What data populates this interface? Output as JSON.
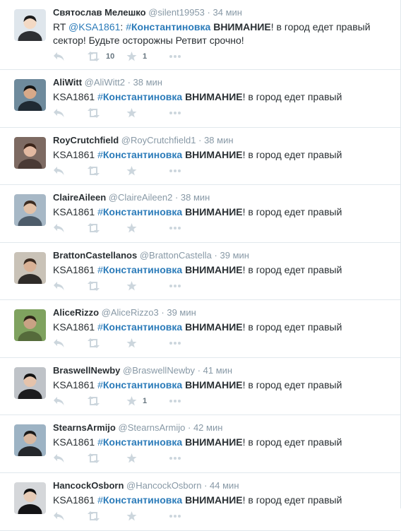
{
  "tweets": [
    {
      "fullname": "Святослав Мелешко",
      "username": "@silent19953",
      "time": "34 мин",
      "text": {
        "prefix": "RT ",
        "mention": "@KSA1861",
        "colon": ": ",
        "hash": "#",
        "hashtag": "Константиновка",
        "space": " ",
        "bold": "ВНИМАНИЕ",
        "rest": "! в город едет правый сектор! Будьте осторожны Ретвит срочно!"
      },
      "retweet_count": "10",
      "favorite_count": "1"
    },
    {
      "fullname": "AliWitt",
      "username": "@AliWitt2",
      "time": "38 мин",
      "text": {
        "prefix": "KSA1861 ",
        "mention": "",
        "colon": "",
        "hash": "#",
        "hashtag": "Константиновка",
        "space": " ",
        "bold": "ВНИМАНИЕ",
        "rest": "! в город едет правый"
      },
      "retweet_count": "",
      "favorite_count": ""
    },
    {
      "fullname": "RoyCrutchfield",
      "username": "@RoyCrutchfield1",
      "time": "38 мин",
      "text": {
        "prefix": "KSA1861 ",
        "mention": "",
        "colon": "",
        "hash": "#",
        "hashtag": "Константиновка",
        "space": " ",
        "bold": "ВНИМАНИЕ",
        "rest": "! в город едет правый"
      },
      "retweet_count": "",
      "favorite_count": ""
    },
    {
      "fullname": "ClaireAileen",
      "username": "@ClaireAileen2",
      "time": "38 мин",
      "text": {
        "prefix": "KSA1861 ",
        "mention": "",
        "colon": "",
        "hash": "#",
        "hashtag": "Константиновка",
        "space": " ",
        "bold": "ВНИМАНИЕ",
        "rest": "! в город едет правый"
      },
      "retweet_count": "",
      "favorite_count": ""
    },
    {
      "fullname": "BrattonCastellanos",
      "username": "@BrattonCastella",
      "time": "39 мин",
      "text": {
        "prefix": "KSA1861 ",
        "mention": "",
        "colon": "",
        "hash": "#",
        "hashtag": "Константиновка",
        "space": " ",
        "bold": "ВНИМАНИЕ",
        "rest": "! в город едет правый"
      },
      "retweet_count": "",
      "favorite_count": ""
    },
    {
      "fullname": "AliceRizzo",
      "username": "@AliceRizzo3",
      "time": "39 мин",
      "text": {
        "prefix": "KSA1861 ",
        "mention": "",
        "colon": "",
        "hash": "#",
        "hashtag": "Константиновка",
        "space": " ",
        "bold": "ВНИМАНИЕ",
        "rest": "! в город едет правый"
      },
      "retweet_count": "",
      "favorite_count": ""
    },
    {
      "fullname": "BraswellNewby",
      "username": "@BraswellNewby",
      "time": "41 мин",
      "text": {
        "prefix": "KSA1861 ",
        "mention": "",
        "colon": "",
        "hash": "#",
        "hashtag": "Константиновка",
        "space": " ",
        "bold": "ВНИМАНИЕ",
        "rest": "! в город едет правый"
      },
      "retweet_count": "",
      "favorite_count": "1"
    },
    {
      "fullname": "StearnsArmijo",
      "username": "@StearnsArmijo",
      "time": "42 мин",
      "text": {
        "prefix": "KSA1861 ",
        "mention": "",
        "colon": "",
        "hash": "#",
        "hashtag": "Константиновка",
        "space": " ",
        "bold": "ВНИМАНИЕ",
        "rest": "! в город едет правый"
      },
      "retweet_count": "",
      "favorite_count": ""
    },
    {
      "fullname": "HancockOsborn",
      "username": "@HancockOsborn",
      "time": "44 мин",
      "text": {
        "prefix": "KSA1861 ",
        "mention": "",
        "colon": "",
        "hash": "#",
        "hashtag": "Константиновка",
        "space": " ",
        "bold": "ВНИМАНИЕ",
        "rest": "! в город едет правый"
      },
      "retweet_count": "",
      "favorite_count": ""
    }
  ],
  "icons": {
    "reply": "reply-icon",
    "retweet": "retweet-icon",
    "favorite": "star-icon",
    "more": "more-icon",
    "avatar": "avatar-photo"
  },
  "colors": {
    "link": "#2b7bb9",
    "muted": "#8899a6",
    "action_icon": "#ccd6dd",
    "border": "#e1e8ed",
    "text": "#292f33"
  }
}
